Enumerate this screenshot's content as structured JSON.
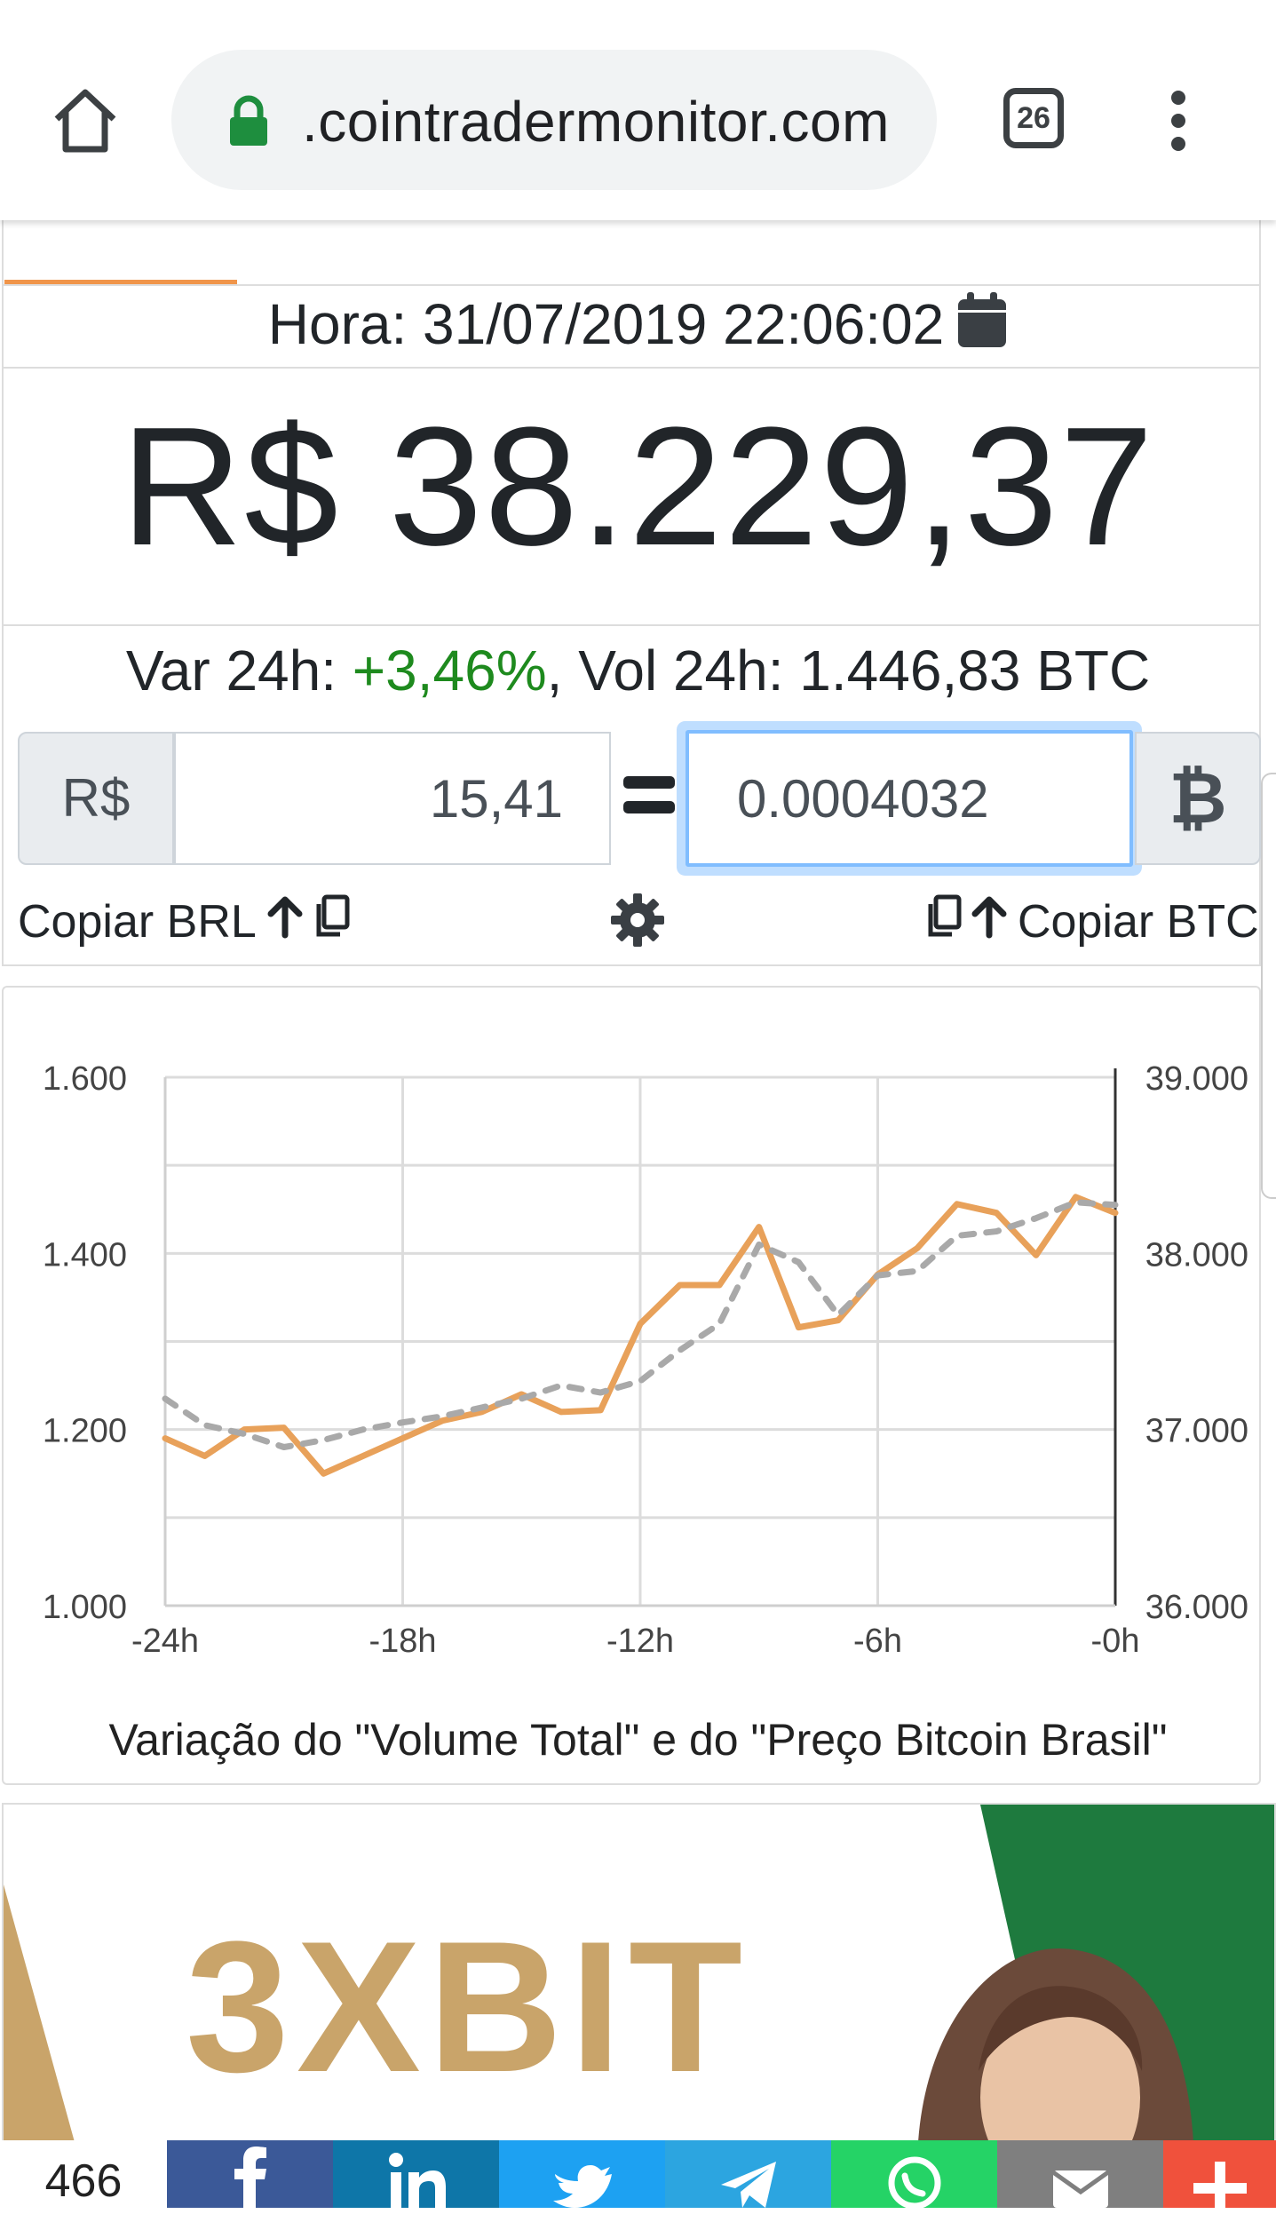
{
  "browser": {
    "url": ".cointradermonitor.com",
    "tab_count": "26"
  },
  "header": {
    "hora_label": "Hora:",
    "timestamp": "31/07/2019 22:06:02"
  },
  "price": {
    "display": "R$ 38.229,37"
  },
  "stats": {
    "var_label": "Var 24h:",
    "var_value": "+3,46%",
    "vol_label": ", Vol 24h: 1.446,83 BTC"
  },
  "converter": {
    "brl_prefix": "R$",
    "brl_value": "15,41",
    "btc_value": "0.0004032",
    "btc_symbol": "₿",
    "copy_brl_label": "Copiar BRL",
    "copy_btc_label": "Copiar BTC"
  },
  "colors": {
    "price_line": "#e8a15a",
    "volume_line": "#a9a9a9",
    "var_positive": "#1e8a1e",
    "accent_tab": "#f0954a"
  },
  "chart_data": {
    "type": "line",
    "title": "Variação do \"Volume Total\" e do \"Preço Bitcoin Brasil\"",
    "x": [
      -24,
      -23,
      -22,
      -21,
      -20,
      -19,
      -18,
      -17,
      -16,
      -15,
      -14,
      -13,
      -12,
      -11,
      -10,
      -9,
      -8,
      -7,
      -6,
      -5,
      -4,
      -3,
      -2,
      -1,
      0
    ],
    "xticks": [
      "-24h",
      "-18h",
      "-12h",
      "-6h",
      "-0h"
    ],
    "y_left_ticks": [
      "1.000",
      "1.200",
      "1.400",
      "1.600"
    ],
    "y_right_ticks": [
      "36.000",
      "37.000",
      "38.000",
      "39.000"
    ],
    "ylim_left": [
      1000,
      1600
    ],
    "ylim_right": [
      36000,
      39000
    ],
    "grid": true,
    "series": [
      {
        "axis": "right",
        "style": "solid",
        "values": [
          36950,
          36850,
          37000,
          37010,
          36750,
          36850,
          36950,
          37050,
          37100,
          37200,
          37100,
          37110,
          37600,
          37820,
          37820,
          38150,
          37580,
          37620,
          37880,
          38030,
          38280,
          38230,
          37990,
          38320,
          38230
        ]
      },
      {
        "axis": "left",
        "style": "dashed",
        "values": [
          1235,
          1205,
          1195,
          1180,
          1188,
          1200,
          1208,
          1215,
          1225,
          1235,
          1250,
          1242,
          1255,
          1290,
          1320,
          1410,
          1390,
          1330,
          1375,
          1380,
          1420,
          1425,
          1440,
          1458,
          1455
        ]
      }
    ]
  },
  "ad": {
    "brand": "3XBIT"
  },
  "share": {
    "count": "466"
  }
}
